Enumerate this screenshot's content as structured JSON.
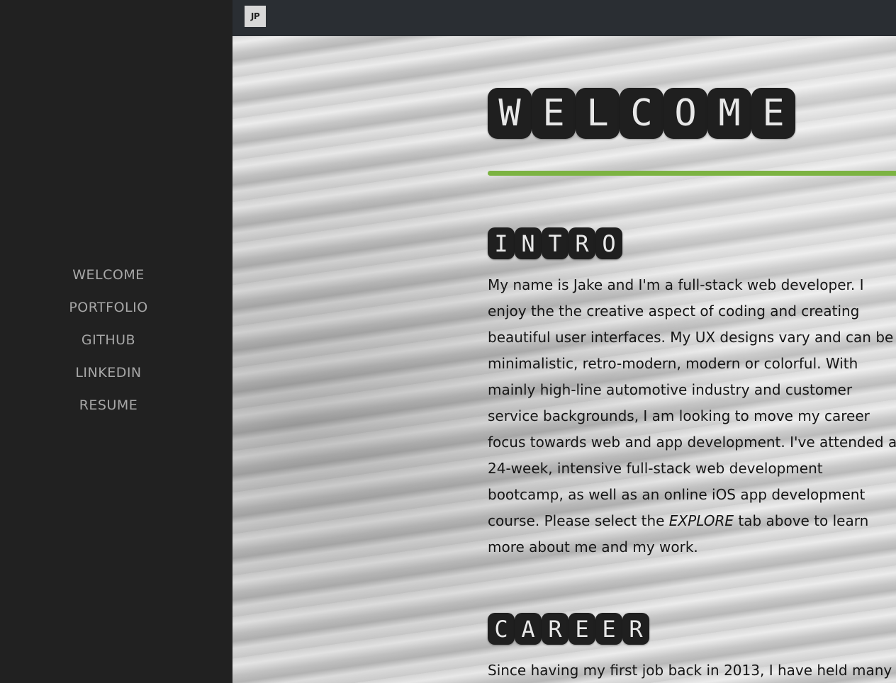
{
  "nav": {
    "items": [
      {
        "label": "WELCOME"
      },
      {
        "label": "PORTFOLIO"
      },
      {
        "label": "GITHUB"
      },
      {
        "label": "LINKEDIN"
      },
      {
        "label": "RESUME"
      }
    ]
  },
  "topbar": {
    "logo_text": "JP"
  },
  "welcome": {
    "letters": [
      "W",
      "E",
      "L",
      "C",
      "O",
      "M",
      "E"
    ]
  },
  "intro": {
    "heading_letters": [
      "I",
      "N",
      "T",
      "R",
      "O"
    ],
    "text_before": "My name is Jake and I'm a full-stack web developer. I enjoy the the creative aspect of coding and creating beautiful user interfaces. My UX designs vary and can be minimalistic, retro-modern, modern or colorful. With mainly high-line automotive industry and customer service backgrounds, I am looking to move my career focus towards web and app development. I've attended a 24-week, intensive full-stack web development bootcamp, as well as an online iOS app development course. Please select the ",
    "emphasis": "EXPLORE",
    "text_after": " tab above to learn more about me and my work."
  },
  "career": {
    "heading_letters": [
      "C",
      "A",
      "R",
      "E",
      "E",
      "R"
    ],
    "text": "Since having my first job back in 2013, I have held many"
  },
  "colors": {
    "accent": "#7cb342",
    "sidebar": "#212121",
    "topbar": "#2a2e33",
    "tile": "#1f1f1f"
  }
}
